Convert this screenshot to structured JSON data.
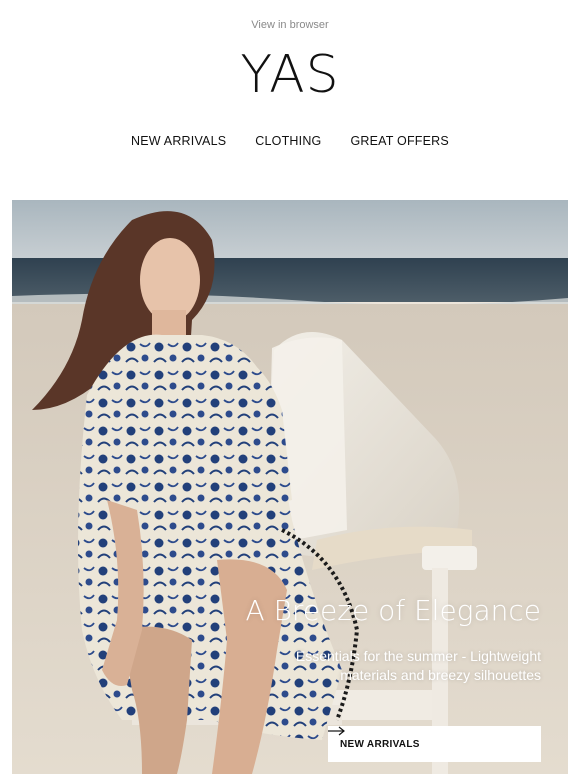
{
  "header": {
    "view_in_browser": "View in browser",
    "logo": "YAS"
  },
  "nav": {
    "items": [
      "NEW ARRIVALS",
      "CLOTHING",
      "GREAT OFFERS"
    ]
  },
  "hero": {
    "title": "A Breeze of Elegance",
    "subtitle": "Essentials for the summer - Lightweight materials and breezy silhouettes",
    "cta_label": "NEW ARRIVALS",
    "cta_icon": "arrow-right-icon"
  },
  "colors": {
    "background": "#ffffff",
    "text": "#111111",
    "muted": "#8a8a8a",
    "sky": "#b6c1c8",
    "sea": "#3a4b5a",
    "sand": "#ddd3c4"
  }
}
